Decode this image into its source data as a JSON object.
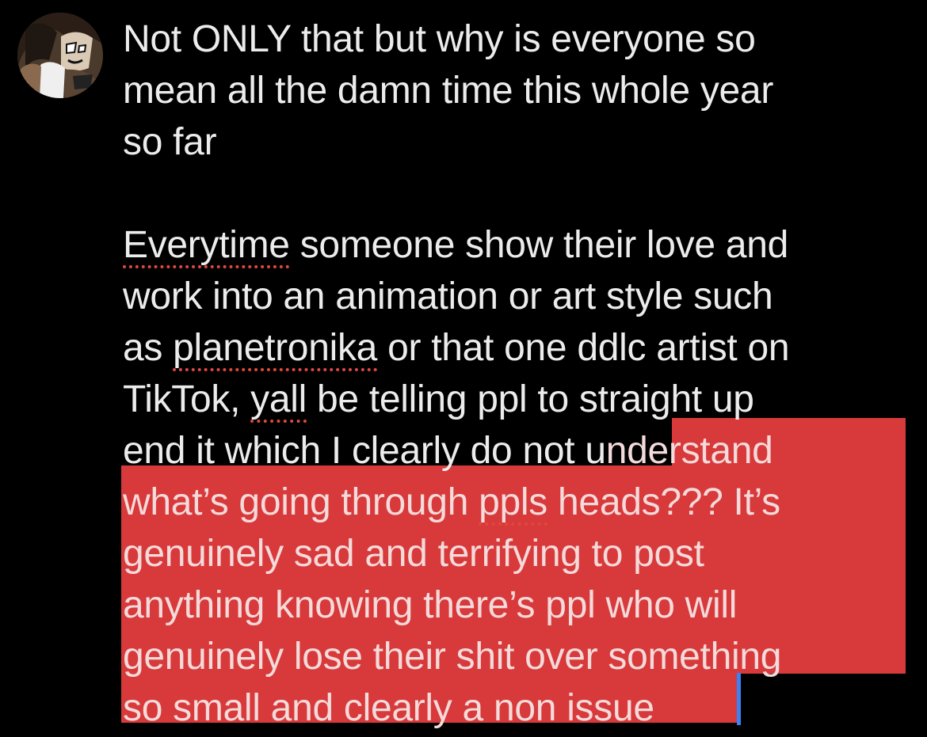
{
  "avatar": {
    "icon": "avatar-cartoon-character"
  },
  "post": {
    "paragraph1": [
      "Not ONLY that but why is everyone so",
      "mean all the damn time this whole year",
      "so far"
    ],
    "p2_l1_word": "Everytime",
    "p2_l1_rest": " someone show their love and",
    "p2_l2": "work into an animation or art style such",
    "p2_l3_a": "as ",
    "p2_l3_word": "planetronika",
    "p2_l3_b": " or that one ddlc artist on",
    "p2_l4_a": "TikTok, ",
    "p2_l4_word": "yall",
    "p2_l4_b": " be telling ppl to straight up",
    "p2_l5_a": "end it which I clearly do not u",
    "p2_l5_sel": "nderstand",
    "p2_l6_a": "what’s going through ",
    "p2_l6_word": "ppls",
    "p2_l6_b": " heads??? It’s",
    "p2_l7": "genuinely sad and terrifying to post",
    "p2_l8": "anything knowing there’s ppl who will",
    "p2_l9": "genuinely lose their shit over something",
    "p2_l10": "so small and clearly a non issue"
  },
  "colors": {
    "background": "#000000",
    "text": "#ECECEC",
    "selection": "#d8393a",
    "spellcheck_underline": "#e0483d",
    "caret": "#3b82f6"
  }
}
